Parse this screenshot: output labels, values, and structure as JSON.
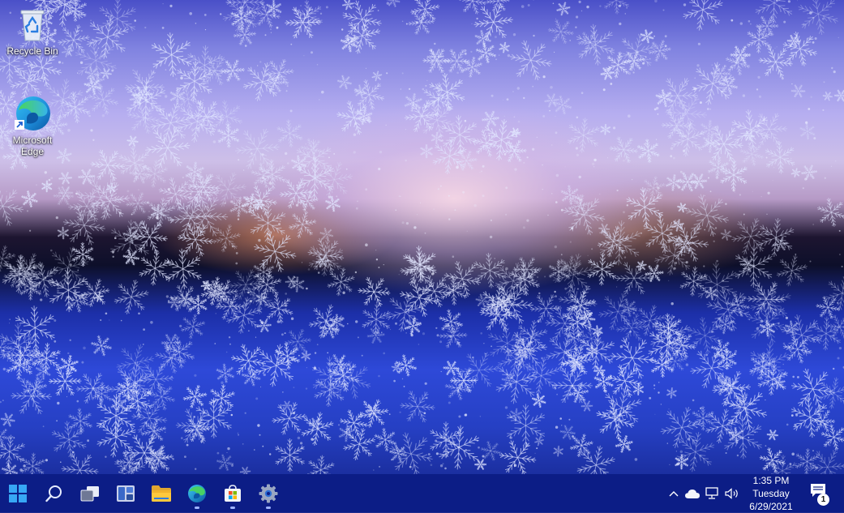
{
  "desktop": {
    "icons": [
      {
        "label": "Recycle Bin",
        "icon": "recycle-bin-icon"
      },
      {
        "label": "Microsoft\nEdge",
        "line1": "Microsoft",
        "line2": "Edge",
        "icon": "edge-icon"
      }
    ]
  },
  "taskbar": {
    "pinned": [
      {
        "name": "start",
        "icon": "windows-logo-icon",
        "running": false
      },
      {
        "name": "search",
        "icon": "search-icon",
        "running": false
      },
      {
        "name": "task-view",
        "icon": "task-view-icon",
        "running": false
      },
      {
        "name": "widgets",
        "icon": "widgets-icon",
        "running": false
      },
      {
        "name": "file-explorer",
        "icon": "folder-icon",
        "running": false
      },
      {
        "name": "edge",
        "icon": "edge-icon",
        "running": true
      },
      {
        "name": "store",
        "icon": "store-icon",
        "running": true
      },
      {
        "name": "settings",
        "icon": "gear-icon",
        "running": true
      }
    ],
    "tray": {
      "icons": [
        "chevron-up-icon",
        "onedrive-cloud-icon",
        "network-icon",
        "volume-icon"
      ],
      "time": "1:35 PM",
      "day": "Tuesday",
      "date": "6/29/2021",
      "notification_count": "1"
    }
  },
  "colors": {
    "taskbar_bg": "#0c1d86",
    "accent": "#0078d4"
  }
}
